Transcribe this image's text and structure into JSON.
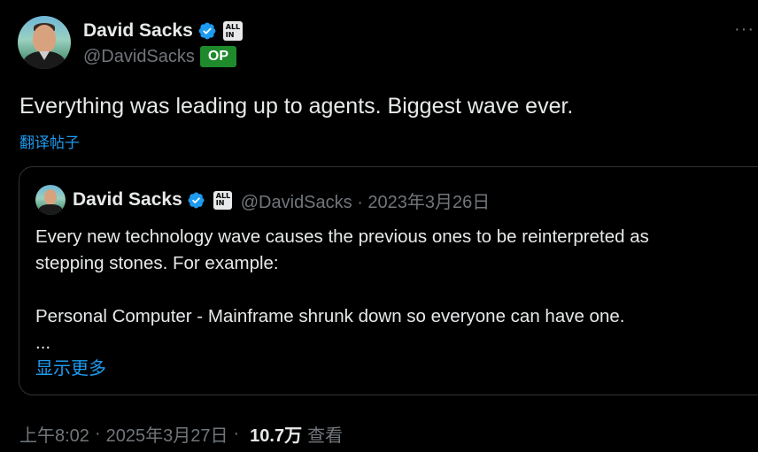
{
  "author": {
    "name": "David Sacks",
    "handle": "@DavidSacks",
    "badge_op": "OP",
    "affiliation_badge": [
      "ALL",
      "IN"
    ],
    "verified_icon": "verified-badge-icon"
  },
  "more_menu": "···",
  "tweet": {
    "text": "Everything was leading up to agents. Biggest wave ever.",
    "translate_link": "翻译帖子"
  },
  "quote": {
    "name": "David Sacks",
    "handle_date": "@DavidSacks · 2023年3月26日",
    "line1": "Every new technology wave causes the previous ones to be reinterpreted as",
    "line2": "stepping stones. For example:",
    "line3": "Personal Computer - Mainframe shrunk down so everyone can have one.",
    "line4": "...",
    "show_more": "显示更多"
  },
  "footer": {
    "time": "上午8:02",
    "date": "2025年3月27日",
    "separator": "·",
    "views_count": "10.7万",
    "views_label": "查看"
  },
  "colors": {
    "background": "#000000",
    "text": "#e7e9ea",
    "secondary": "#71767b",
    "link": "#1d9bf0",
    "verified": "#1d9bf0",
    "op_badge": "#1e8a2c"
  }
}
